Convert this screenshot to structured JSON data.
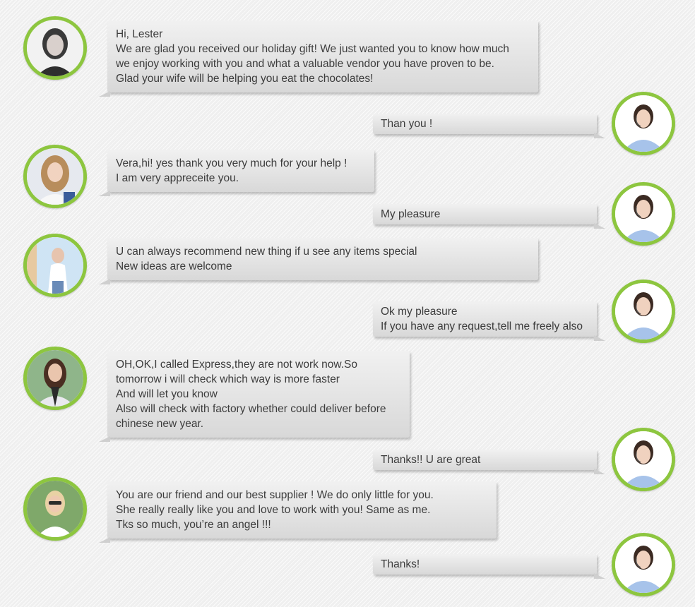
{
  "colors": {
    "avatar_ring": "#8dc63f",
    "bubble_top": "#f1f1f1",
    "bubble_bottom": "#d8d8d8",
    "text": "#3c3c3c"
  },
  "messages": [
    {
      "side": "left",
      "avatar": "customer-avatar-icon",
      "lines": [
        "Hi,  Lester",
        "We are glad you received our holiday gift! We just wanted you to know how much",
        "we enjoy working with you and what a valuable vendor you have proven to be.",
        "Glad your wife will be helping you eat the chocolates!"
      ]
    },
    {
      "side": "right",
      "avatar": "agent-avatar-icon",
      "lines": [
        "Than you !"
      ]
    },
    {
      "side": "left",
      "avatar": "customer-avatar-icon",
      "lines": [
        "Vera,hi! yes thank you very much for your help !",
        "I am very appreceite you."
      ]
    },
    {
      "side": "right",
      "avatar": "agent-avatar-icon",
      "lines": [
        "My pleasure"
      ]
    },
    {
      "side": "left",
      "avatar": "customer-avatar-icon",
      "lines": [
        "U can always recommend new thing if u see any items special",
        "New ideas are welcome"
      ]
    },
    {
      "side": "right",
      "avatar": "agent-avatar-icon",
      "lines": [
        "Ok my pleasure",
        "If you have any request,tell me freely also"
      ]
    },
    {
      "side": "left",
      "avatar": "customer-avatar-icon",
      "lines": [
        "OH,OK,I called Express,they are not work now.So",
        "tomorrow i will check which way is more faster",
        "And will let you know",
        "Also will check with factory whether could deliver before",
        "chinese new year."
      ]
    },
    {
      "side": "right",
      "avatar": "agent-avatar-icon",
      "lines": [
        "Thanks!! U are great"
      ]
    },
    {
      "side": "left",
      "avatar": "customer-avatar-icon",
      "lines": [
        "You are our friend and our best supplier ! We do only little for you.",
        "She really really like you and love to work with you! Same as me.",
        "Tks so much, you’re an angel !!!"
      ]
    },
    {
      "side": "right",
      "avatar": "agent-avatar-icon",
      "lines": [
        "Thanks!"
      ]
    }
  ]
}
